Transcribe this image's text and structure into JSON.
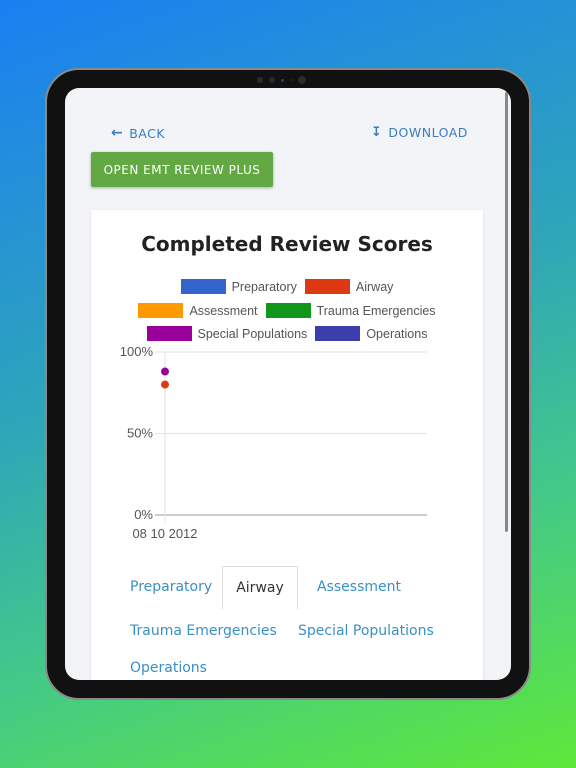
{
  "nav": {
    "back_label": "BACK",
    "download_label": "DOWNLOAD",
    "open_button": "OPEN EMT REVIEW PLUS"
  },
  "card": {
    "title": "Completed Review Scores"
  },
  "chart_data": {
    "type": "scatter",
    "title": "Completed Review Scores",
    "legend": [
      {
        "name": "Preparatory",
        "color": "#3366cc"
      },
      {
        "name": "Airway",
        "color": "#dc3912"
      },
      {
        "name": "Assessment",
        "color": "#ff9900"
      },
      {
        "name": "Trauma Emergencies",
        "color": "#109618"
      },
      {
        "name": "Special Populations",
        "color": "#990099"
      },
      {
        "name": "Operations",
        "color": "#3b3eac"
      }
    ],
    "y_ticks": [
      "100%",
      "50%",
      "0%"
    ],
    "ylim": [
      0,
      100
    ],
    "x_ticks": [
      "08 10 2012"
    ],
    "series": [
      {
        "name": "Airway",
        "x": "08 10 2012",
        "y": 80
      },
      {
        "name": "Special Populations",
        "x": "08 10 2012",
        "y": 88
      }
    ],
    "grid": true,
    "legend_position": "top"
  },
  "tabs": [
    "Preparatory",
    "Airway",
    "Assessment",
    "Trauma Emergencies",
    "Special Populations",
    "Operations"
  ],
  "active_tab": "Airway"
}
